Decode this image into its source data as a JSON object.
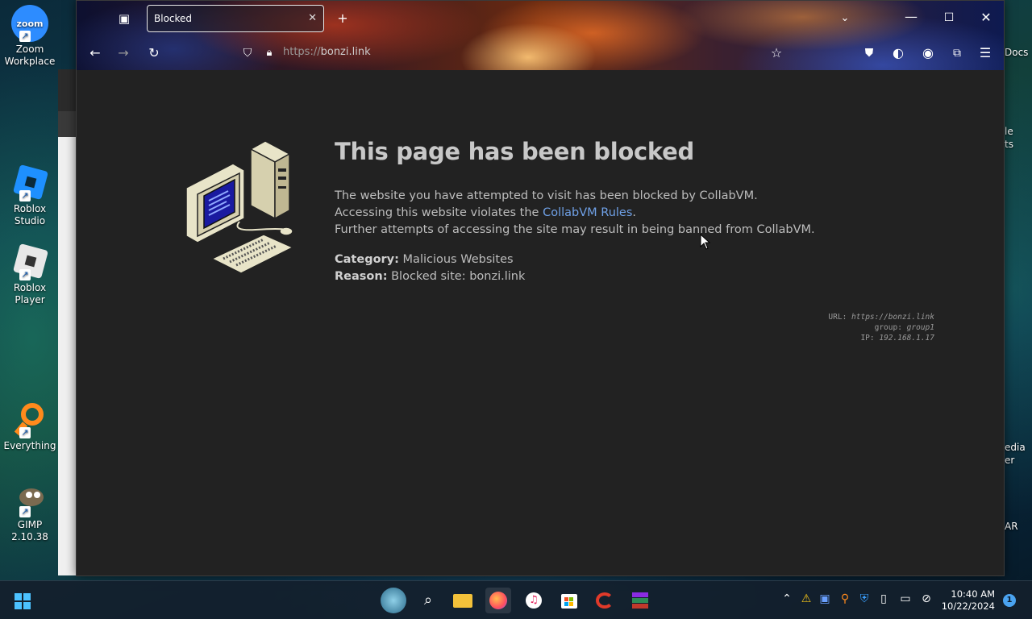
{
  "desktop": {
    "icons": [
      {
        "label": "Zoom\nWorkplace",
        "icon": "zoom-icon"
      },
      {
        "label": "Roblox\nStudio",
        "icon": "roblox-studio-icon"
      },
      {
        "label": "Roblox\nPlayer",
        "icon": "roblox-player-icon"
      },
      {
        "label": "Everything",
        "icon": "everything-search-icon"
      },
      {
        "label": "GIMP 2.10.38",
        "icon": "gimp-icon"
      }
    ],
    "right_peek": [
      "Docs",
      "le",
      "ts",
      "edia",
      "er",
      "AR"
    ]
  },
  "browser": {
    "tab_title": "Blocked",
    "url_dim": "https://",
    "url_host": "bonzi.link",
    "toolbar_icons": [
      "back-icon",
      "forward-icon",
      "reload-icon",
      "tracking-shield-icon",
      "lock-icon",
      "bookmark-star-icon",
      "pocket-icon",
      "theme-icon",
      "account-icon",
      "extensions-icon",
      "menu-icon"
    ]
  },
  "page": {
    "title": "This page has been blocked",
    "line1": "The website you have attempted to visit has been blocked by CollabVM.",
    "line2_pre": "Accessing this website violates the ",
    "line2_link": "CollabVM Rules",
    "line2_post": ".",
    "line3": "Further attempts of accessing the site may result in being banned from CollabVM.",
    "category_label": "Category:",
    "category_value": "Malicious Websites",
    "reason_label": "Reason:",
    "reason_value": "Blocked site: bonzi.link",
    "info_url_label": "URL:",
    "info_url_value": "https://bonzi.link",
    "info_group_label": "group:",
    "info_group_value": "group1",
    "info_ip_label": "IP:",
    "info_ip_value": "192.168.1.17"
  },
  "taskbar": {
    "time": "10:40 AM",
    "date": "10/22/2024",
    "notification_count": "1"
  }
}
